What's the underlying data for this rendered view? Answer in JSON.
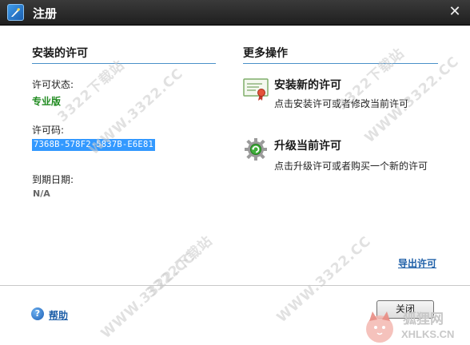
{
  "window": {
    "title": "注册"
  },
  "left": {
    "heading": "安装的许可",
    "status_label": "许可状态:",
    "status_value": "专业版",
    "key_label": "许可码:",
    "key_value": "7368B-578F2-5837B-E6E81",
    "expiry_label": "到期日期:",
    "expiry_value": "N/A"
  },
  "right": {
    "heading": "更多操作",
    "actions": [
      {
        "title": "安装新的许可",
        "desc": "点击安装许可或者修改当前许可",
        "icon": "certificate-icon"
      },
      {
        "title": "升级当前许可",
        "desc": "点击升级许可或者购买一个新的许可",
        "icon": "upgrade-gear-icon"
      }
    ],
    "export_link": "导出许可"
  },
  "footer": {
    "help_label": "帮助",
    "close_label": "关闭"
  },
  "watermarks": [
    "3322下载站",
    "WWW.3322.CC"
  ],
  "corner_logo": {
    "cn": "狐狸网",
    "en": "XHLKS.CN"
  },
  "colors": {
    "titlebar": "#2b2b2b",
    "accent_rule": "#4a90c8",
    "status_green": "#1f8a1f",
    "selection": "#3399ff",
    "link": "#1e5fa8"
  }
}
